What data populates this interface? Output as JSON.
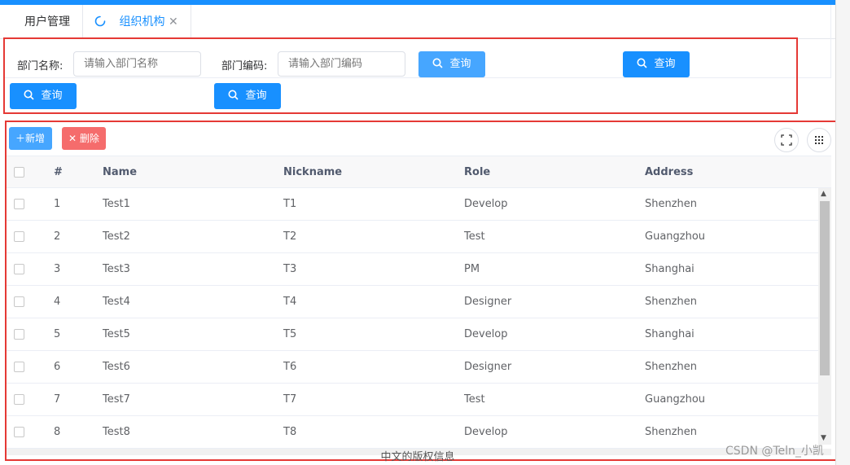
{
  "tabs": [
    {
      "label": "用户管理",
      "active": false
    },
    {
      "label": "组织机构",
      "active": true
    }
  ],
  "search": {
    "dept_name_label": "部门名称:",
    "dept_name_placeholder": "请输入部门名称",
    "dept_code_label": "部门编码:",
    "dept_code_placeholder": "请输入部门编码",
    "query_label": "查询"
  },
  "toolbar": {
    "add_label": "新增",
    "delete_label": "删除"
  },
  "table": {
    "columns": [
      "#",
      "Name",
      "Nickname",
      "Role",
      "Address"
    ],
    "rows": [
      {
        "idx": "1",
        "name": "Test1",
        "nickname": "T1",
        "role": "Develop",
        "address": "Shenzhen"
      },
      {
        "idx": "2",
        "name": "Test2",
        "nickname": "T2",
        "role": "Test",
        "address": "Guangzhou"
      },
      {
        "idx": "3",
        "name": "Test3",
        "nickname": "T3",
        "role": "PM",
        "address": "Shanghai"
      },
      {
        "idx": "4",
        "name": "Test4",
        "nickname": "T4",
        "role": "Designer",
        "address": "Shenzhen"
      },
      {
        "idx": "5",
        "name": "Test5",
        "nickname": "T5",
        "role": "Develop",
        "address": "Shanghai"
      },
      {
        "idx": "6",
        "name": "Test6",
        "nickname": "T6",
        "role": "Designer",
        "address": "Shenzhen"
      },
      {
        "idx": "7",
        "name": "Test7",
        "nickname": "T7",
        "role": "Test",
        "address": "Guangzhou"
      },
      {
        "idx": "8",
        "name": "Test8",
        "nickname": "T8",
        "role": "Develop",
        "address": "Shenzhen"
      }
    ]
  },
  "footer": {
    "copyright": "中文的版权信息",
    "watermark": "CSDN @Teln_小凯"
  },
  "colors": {
    "primary": "#1890ff",
    "danger": "#f56c6c",
    "highlight_border": "#e53935"
  }
}
